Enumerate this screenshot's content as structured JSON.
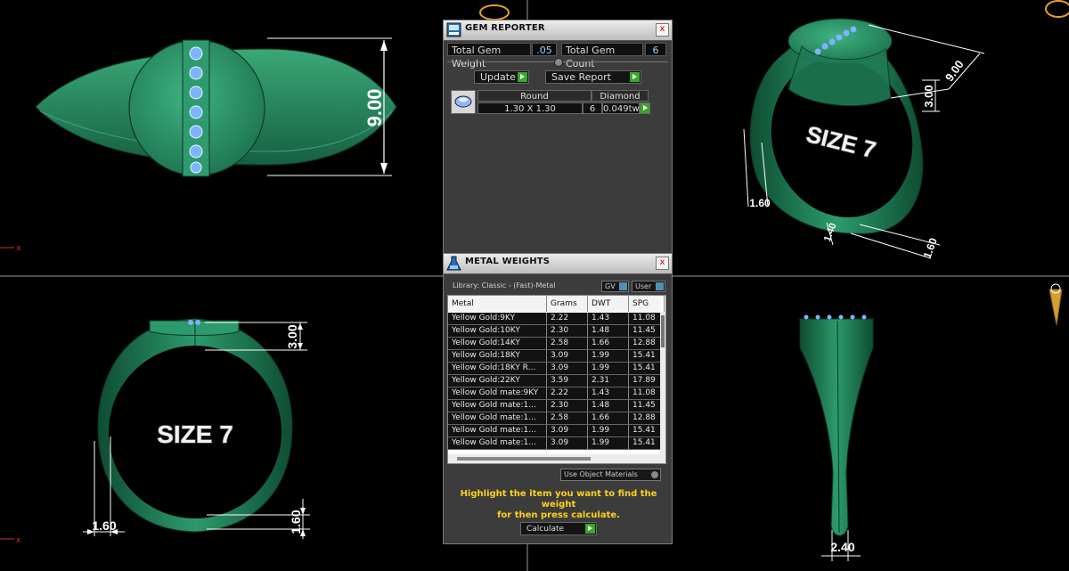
{
  "viewport": {
    "top_view_dimension": "9.00",
    "side_view_dimension_top": "3.00",
    "side_view_dimension_band": "1.60",
    "front_view_dimension_top": "3.00",
    "front_view_dimension_left": "1.60",
    "front_view_dimension_right": "1.60",
    "side_view_size_label": "SIZE 7",
    "front_view_size_label": "SIZE 7",
    "persp_dimension_diag": "9.00",
    "persp_dimension_height": "3.00",
    "persp_dimension_left": "1.60",
    "persp_dimension_bottom_a": "1.40",
    "persp_dimension_bottom_b": "1.60",
    "persp_size_label": "SIZE 7",
    "bottom_view_dimension": "2.40",
    "axis_label": "x",
    "ring_color": "#1f7a55",
    "gem_color": "#7fb3ff",
    "axis_color": "#d23030"
  },
  "gem_reporter": {
    "title": "GEM REPORTER",
    "close": "x",
    "total_weight_label": "Total Gem Weight",
    "total_weight_value": ".05",
    "total_count_label": "Total Gem Count",
    "total_count_value": "6",
    "update_label": "Update",
    "save_report_label": "Save Report",
    "table": {
      "shape_header": "Round",
      "material_header": "Diamond",
      "size": "1.30 X 1.30",
      "count": "6",
      "weight": "0.049tw"
    }
  },
  "metal_weights": {
    "title": "METAL WEIGHTS",
    "close": "x",
    "library": "Library: Classic - (Fast)-Metal",
    "gv_label": "GV",
    "user_label": "User",
    "columns": [
      "Metal",
      "Grams",
      "DWT",
      "SPG"
    ],
    "rows": [
      [
        "Yellow Gold:9KY",
        "2.22",
        "1.43",
        "11.08"
      ],
      [
        "Yellow Gold:10KY",
        "2.30",
        "1.48",
        "11.45"
      ],
      [
        "Yellow Gold:14KY",
        "2.58",
        "1.66",
        "12.88"
      ],
      [
        "Yellow Gold:18KY",
        "3.09",
        "1.99",
        "15.41"
      ],
      [
        "Yellow Gold:18KY R...",
        "3.09",
        "1.99",
        "15.41"
      ],
      [
        "Yellow Gold:22KY",
        "3.59",
        "2.31",
        "17.89"
      ],
      [
        "Yellow Gold mate:9KY",
        "2.22",
        "1.43",
        "11.08"
      ],
      [
        "Yellow Gold mate:1...",
        "2.30",
        "1.48",
        "11.45"
      ],
      [
        "Yellow Gold mate:1...",
        "2.58",
        "1.66",
        "12.88"
      ],
      [
        "Yellow Gold mate:1...",
        "3.09",
        "1.99",
        "15.41"
      ],
      [
        "Yellow Gold mate:1...",
        "3.09",
        "1.99",
        "15.41"
      ]
    ],
    "use_object_materials": "Use Object Materials",
    "hint_line1": "Highlight the item you want to find the weight",
    "hint_line2": "for then press calculate.",
    "calculate_label": "Calculate"
  }
}
